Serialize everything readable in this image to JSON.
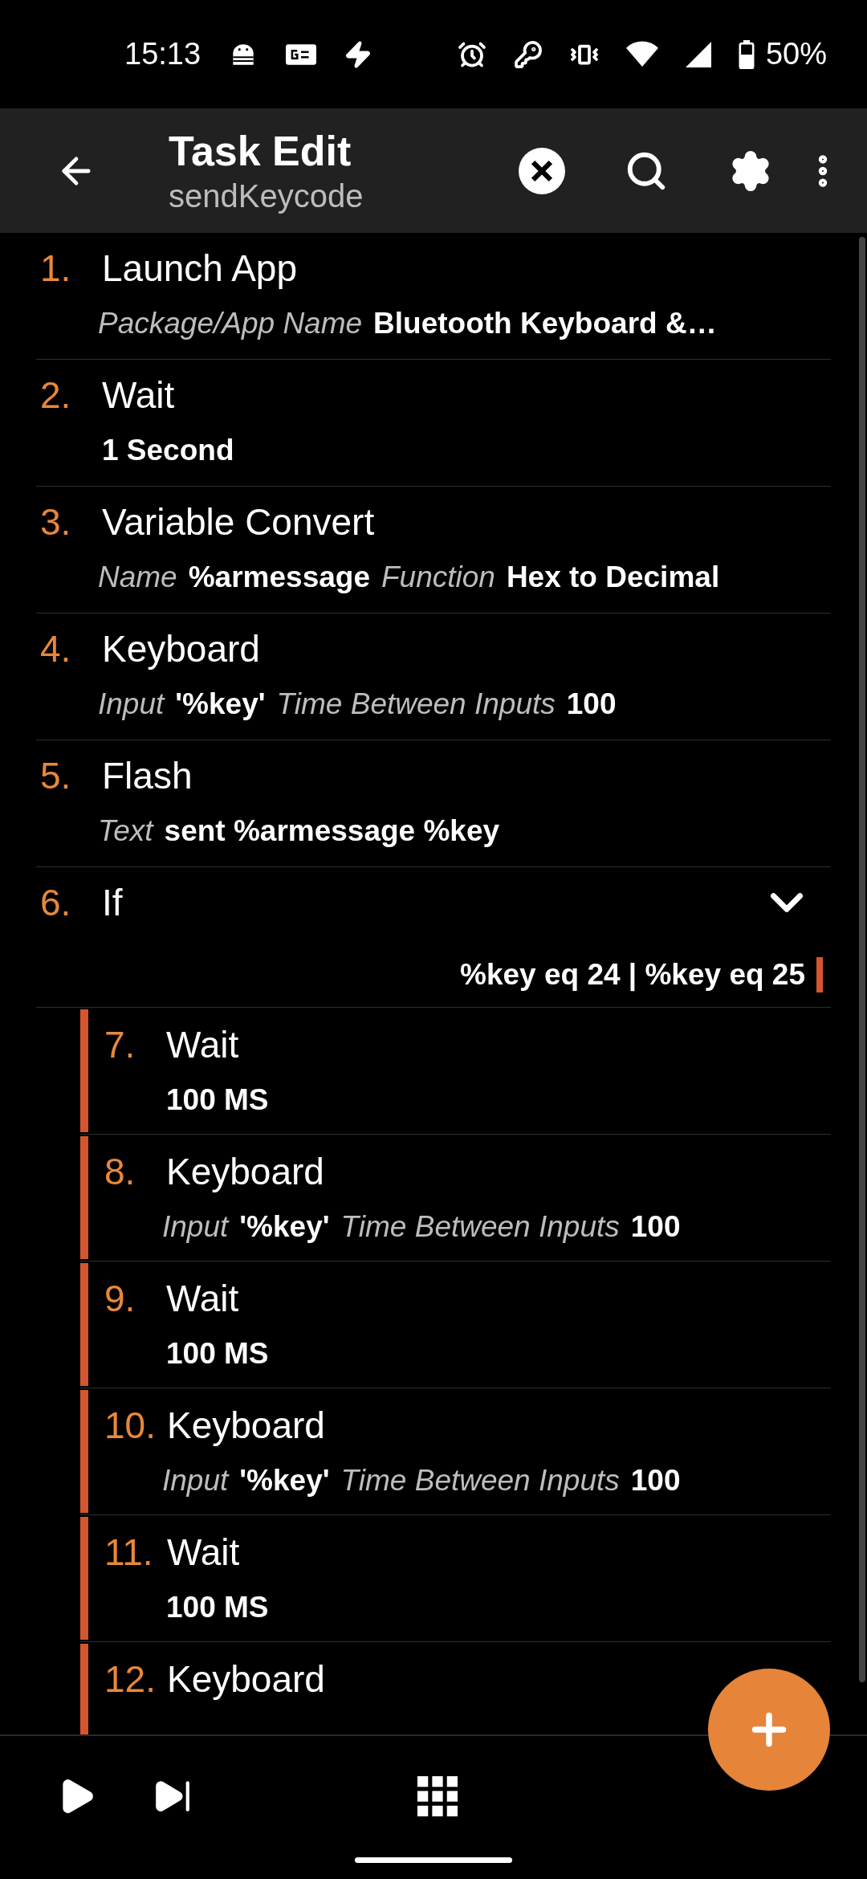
{
  "status_bar": {
    "time": "15:13",
    "battery": "50%"
  },
  "header": {
    "title": "Task Edit",
    "subtitle": "sendKeycode"
  },
  "actions": [
    {
      "number": "1.",
      "name": "Launch App",
      "params": [
        {
          "label": "Package/App Name",
          "value": "Bluetooth Keyboard &…"
        }
      ]
    },
    {
      "number": "2.",
      "name": "Wait",
      "params": [
        {
          "value": "1 Second"
        }
      ]
    },
    {
      "number": "3.",
      "name": "Variable Convert",
      "params": [
        {
          "label": "Name",
          "value": "%armessage"
        },
        {
          "label": "Function",
          "value": "Hex to Decimal"
        }
      ]
    },
    {
      "number": "4.",
      "name": "Keyboard",
      "params": [
        {
          "label": "Input",
          "value": "'%key'"
        },
        {
          "label": "Time Between Inputs",
          "value": "100"
        }
      ]
    },
    {
      "number": "5.",
      "name": "Flash",
      "params": [
        {
          "label": "Text",
          "value": "sent %armessage %key"
        }
      ]
    },
    {
      "number": "6.",
      "name": "If",
      "expanded": true,
      "condition": "%key eq 24 | %key eq 25",
      "children": [
        {
          "number": "7.",
          "name": "Wait",
          "params": [
            {
              "value": "100 MS"
            }
          ]
        },
        {
          "number": "8.",
          "name": "Keyboard",
          "params": [
            {
              "label": "Input",
              "value": "'%key'"
            },
            {
              "label": "Time Between Inputs",
              "value": "100"
            }
          ]
        },
        {
          "number": "9.",
          "name": "Wait",
          "params": [
            {
              "value": "100 MS"
            }
          ]
        },
        {
          "number": "10.",
          "name": "Keyboard",
          "params": [
            {
              "label": "Input",
              "value": "'%key'"
            },
            {
              "label": "Time Between Inputs",
              "value": "100"
            }
          ]
        },
        {
          "number": "11.",
          "name": "Wait",
          "params": [
            {
              "value": "100 MS"
            }
          ]
        },
        {
          "number": "12.",
          "name": "Keyboard"
        }
      ]
    }
  ]
}
